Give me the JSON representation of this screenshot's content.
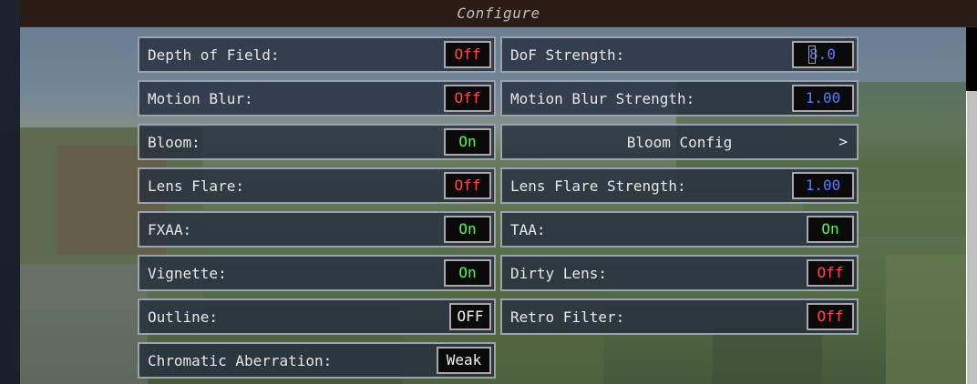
{
  "window": {
    "title": "Configure"
  },
  "options_left": [
    {
      "label": "Depth of Field:",
      "value": "Off",
      "state": "off"
    },
    {
      "label": "Motion Blur:",
      "value": "Off",
      "state": "off"
    },
    {
      "label": "Bloom:",
      "value": "On",
      "state": "on"
    },
    {
      "label": "Lens Flare:",
      "value": "Off",
      "state": "off"
    },
    {
      "label": "FXAA:",
      "value": "On",
      "state": "on"
    },
    {
      "label": "Vignette:",
      "value": "On",
      "state": "on"
    },
    {
      "label": "Outline:",
      "value": "OFF",
      "state": "white"
    },
    {
      "label": "Chromatic Aberration:",
      "value": "Weak",
      "state": "white"
    }
  ],
  "options_right": [
    {
      "label": "DoF Strength:",
      "value": "8.0",
      "state": "num"
    },
    {
      "label": "Motion Blur Strength:",
      "value": "1.00",
      "state": "num"
    },
    {
      "label": "Bloom Config",
      "chevron": ">"
    },
    {
      "label": "Lens Flare Strength:",
      "value": "1.00",
      "state": "num"
    },
    {
      "label": "TAA:",
      "value": "On",
      "state": "on"
    },
    {
      "label": "Dirty Lens:",
      "value": "Off",
      "state": "off"
    },
    {
      "label": "Retro Filter:",
      "value": "Off",
      "state": "off"
    }
  ],
  "colors": {
    "off": "#ff4a4a",
    "on": "#4aff4a",
    "number": "#5a7dff",
    "label": "#e8e8e8"
  }
}
